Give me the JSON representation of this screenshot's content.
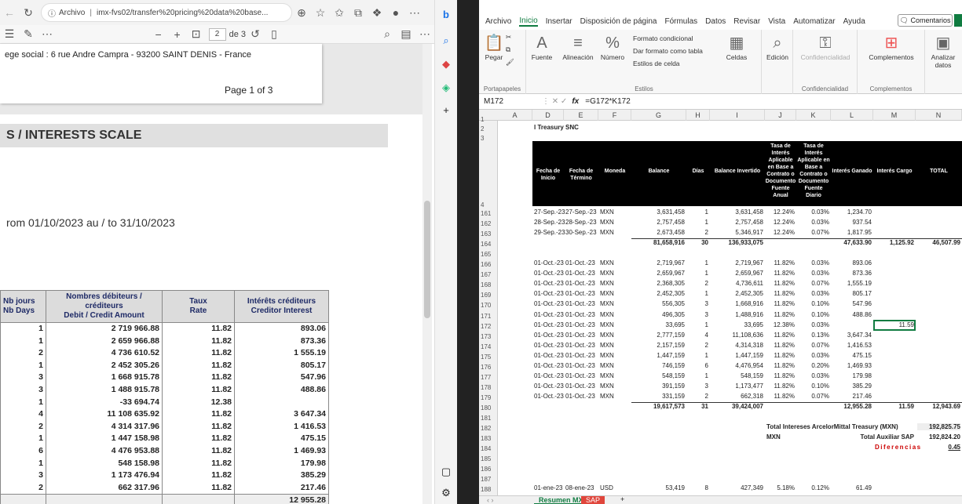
{
  "browser": {
    "address_prefix": "Archivo",
    "address_url": "imx-fvs02/transfer%20pricing%20data%20base..."
  },
  "pdf_toolbar": {
    "zoom_minus": "−",
    "zoom_plus": "+",
    "page_current": "2",
    "page_total": "de 3"
  },
  "pdf": {
    "siege": "ege social : 6 rue Andre Campra - 93200 SAINT DENIS - France",
    "page_label": "Page 1 of 3",
    "band_title": "S / INTERESTS SCALE",
    "period": "rom   01/10/2023   au / to   31/10/2023",
    "table": {
      "headers": [
        [
          "Nb jours",
          "Nb Days"
        ],
        [
          "Nombres débiteurs / créditeurs",
          "Debit / Credit Amount"
        ],
        [
          "Taux",
          "Rate"
        ],
        [
          "Intérêts créditeurs",
          "Creditor Interest"
        ]
      ],
      "rows": [
        [
          "1",
          "2 719 966.88",
          "11.82",
          "893.06"
        ],
        [
          "1",
          "2 659 966.88",
          "11.82",
          "873.36"
        ],
        [
          "2",
          "4 736 610.52",
          "11.82",
          "1 555.19"
        ],
        [
          "1",
          "2 452 305.26",
          "11.82",
          "805.17"
        ],
        [
          "3",
          "1 668 915.78",
          "11.82",
          "547.96"
        ],
        [
          "3",
          "1 488 915.78",
          "11.82",
          "488.86"
        ],
        [
          "1",
          "-33 694.74",
          "12.38",
          ""
        ],
        [
          "4",
          "11 108 635.92",
          "11.82",
          "3 647.34"
        ],
        [
          "2",
          "4 314 317.96",
          "11.82",
          "1 416.53"
        ],
        [
          "1",
          "1 447 158.98",
          "11.82",
          "475.15"
        ],
        [
          "6",
          "4 476 953.88",
          "11.82",
          "1 469.93"
        ],
        [
          "1",
          "548 158.98",
          "11.82",
          "179.98"
        ],
        [
          "3",
          "1 173 476.94",
          "11.82",
          "385.29"
        ],
        [
          "2",
          "662 317.96",
          "11.82",
          "217.46"
        ]
      ],
      "total": "12 955.28"
    }
  },
  "excel": {
    "menu": [
      "Archivo",
      "Inicio",
      "Insertar",
      "Disposición de página",
      "Fórmulas",
      "Datos",
      "Revisar",
      "Vista",
      "Automatizar",
      "Ayuda"
    ],
    "comments_label": "Comentarios",
    "ribbon": {
      "paste": "Pegar",
      "clipboard": "Portapapeles",
      "font": "Fuente",
      "alignment": "Alineación",
      "number": "Número",
      "cond_format": "Formato condicional",
      "table_format": "Dar formato como tabla",
      "cell_styles": "Estilos de celda",
      "styles": "Estilos",
      "cells": "Celdas",
      "editing": "Edición",
      "confidentiality": "Confidencialidad",
      "confidentiality_group": "Confidencialidad",
      "addins": "Complementos",
      "addins_group": "Complementos",
      "analyze": "Analizar datos"
    },
    "name_box": "M172",
    "formula": "=G172*K172",
    "columns": [
      "A",
      "D",
      "E",
      "F",
      "G",
      "H",
      "I",
      "J",
      "K",
      "L",
      "M",
      "N"
    ],
    "company": "l Treasury SNC",
    "headers": {
      "D": "Fecha de Inicio",
      "E": "Fecha de Término",
      "F": "Moneda",
      "G": "Balance",
      "H": "Días",
      "I": "Balance Invertido",
      "J": "Tasa de Interés Aplicable en Base a Contrato o Documento Fuente Anual",
      "K": "Tasa de Interés Aplicable en Base a Contrato o Documento Fuente Diario",
      "L": "Interés Ganado",
      "M": "Interés Cargo",
      "N": "TOTAL"
    },
    "sept_rows": [
      [
        "161",
        "27-Sep.-23",
        "27-Sep.-23",
        "MXN",
        "3,631,458",
        "1",
        "3,631,458",
        "12.24%",
        "0.03%",
        "1,234.70"
      ],
      [
        "162",
        "28-Sep.-23",
        "28-Sep.-23",
        "MXN",
        "2,757,458",
        "1",
        "2,757,458",
        "12.24%",
        "0.03%",
        "937.54"
      ],
      [
        "163",
        "29-Sep.-23",
        "30-Sep.-23",
        "MXN",
        "2,673,458",
        "2",
        "5,346,917",
        "12.24%",
        "0.07%",
        "1,817.95"
      ]
    ],
    "sept_total": {
      "row": "164",
      "G": "81,658,916",
      "H": "30",
      "I": "136,933,075",
      "L": "47,633.90",
      "M": "1,125.92",
      "N": "46,507.99"
    },
    "oct_rows": [
      [
        "166",
        "01-Oct.-23",
        "01-Oct.-23",
        "MXN",
        "2,719,967",
        "1",
        "2,719,967",
        "11.82%",
        "0.03%",
        "893.06",
        ""
      ],
      [
        "167",
        "01-Oct.-23",
        "01-Oct.-23",
        "MXN",
        "2,659,967",
        "1",
        "2,659,967",
        "11.82%",
        "0.03%",
        "873.36",
        ""
      ],
      [
        "168",
        "01-Oct.-23",
        "01-Oct.-23",
        "MXN",
        "2,368,305",
        "2",
        "4,736,611",
        "11.82%",
        "0.07%",
        "1,555.19",
        ""
      ],
      [
        "169",
        "01-Oct.-23",
        "01-Oct.-23",
        "MXN",
        "2,452,305",
        "1",
        "2,452,305",
        "11.82%",
        "0.03%",
        "805.17",
        ""
      ],
      [
        "170",
        "01-Oct.-23",
        "01-Oct.-23",
        "MXN",
        "556,305",
        "3",
        "1,668,916",
        "11.82%",
        "0.10%",
        "547.96",
        ""
      ],
      [
        "171",
        "01-Oct.-23",
        "01-Oct.-23",
        "MXN",
        "496,305",
        "3",
        "1,488,916",
        "11.82%",
        "0.10%",
        "488.86",
        ""
      ],
      [
        "172",
        "01-Oct.-23",
        "01-Oct.-23",
        "MXN",
        "33,695",
        "1",
        "33,695",
        "12.38%",
        "0.03%",
        "",
        "11.59"
      ],
      [
        "173",
        "01-Oct.-23",
        "01-Oct.-23",
        "MXN",
        "2,777,159",
        "4",
        "11,108,636",
        "11.82%",
        "0.13%",
        "3,647.34",
        ""
      ],
      [
        "174",
        "01-Oct.-23",
        "01-Oct.-23",
        "MXN",
        "2,157,159",
        "2",
        "4,314,318",
        "11.82%",
        "0.07%",
        "1,416.53",
        ""
      ],
      [
        "175",
        "01-Oct.-23",
        "01-Oct.-23",
        "MXN",
        "1,447,159",
        "1",
        "1,447,159",
        "11.82%",
        "0.03%",
        "475.15",
        ""
      ],
      [
        "176",
        "01-Oct.-23",
        "01-Oct.-23",
        "MXN",
        "746,159",
        "6",
        "4,476,954",
        "11.82%",
        "0.20%",
        "1,469.93",
        ""
      ],
      [
        "177",
        "01-Oct.-23",
        "01-Oct.-23",
        "MXN",
        "548,159",
        "1",
        "548,159",
        "11.82%",
        "0.03%",
        "179.98",
        ""
      ],
      [
        "178",
        "01-Oct.-23",
        "01-Oct.-23",
        "MXN",
        "391,159",
        "3",
        "1,173,477",
        "11.82%",
        "0.10%",
        "385.29",
        ""
      ],
      [
        "179",
        "01-Oct.-23",
        "01-Oct.-23",
        "MXN",
        "331,159",
        "2",
        "662,318",
        "11.82%",
        "0.07%",
        "217.46",
        ""
      ]
    ],
    "oct_total": {
      "row": "180",
      "G": "19,617,573",
      "H": "31",
      "I": "39,424,007",
      "L": "12,955.28",
      "M": "11.59",
      "N": "12,943.69"
    },
    "summary": {
      "label1": "Total Intereses ArcelorMittal Treasury (MXN)",
      "value1": "192,825.75",
      "currency": "MXN",
      "label2": "Total Auxiliar SAP",
      "value2": "192,824.20",
      "label3": "Diferencias",
      "value3": "0.45"
    },
    "jan_row": [
      "188",
      "01-ene-23",
      "08-ene-23",
      "USD",
      "53,419",
      "8",
      "427,349",
      "5.18%",
      "0.12%",
      "61.49"
    ],
    "row_numbers": [
      "1",
      "2",
      "3",
      "4",
      "161",
      "162",
      "163",
      "164",
      "165",
      "166",
      "167",
      "168",
      "169",
      "170",
      "171",
      "172",
      "173",
      "174",
      "175",
      "176",
      "177",
      "178",
      "179",
      "180",
      "181",
      "182",
      "183",
      "184",
      "185",
      "186",
      "187",
      "188"
    ],
    "sheet_tabs": [
      "Resumen MX13",
      "SAP"
    ]
  }
}
